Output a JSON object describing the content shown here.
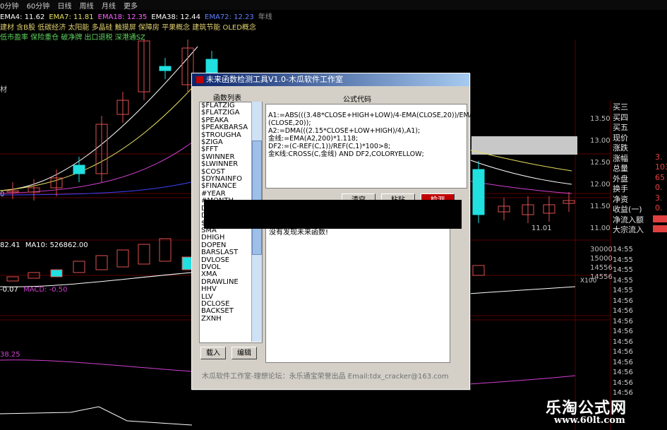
{
  "colors": {
    "up": "#e05050",
    "down": "#20e0e0",
    "grid": "#5a0000",
    "ema_white": "#ffffff",
    "ema_yellow": "#e8e060",
    "ema_magenta": "#d040d0",
    "ema_blue": "#4040ff"
  },
  "period_tabs": [
    "0分钟",
    "60分钟",
    "日线",
    "周线",
    "月线",
    "更多"
  ],
  "ema_legend": [
    {
      "label": "EMA4: 11.62",
      "color": "#ffffff"
    },
    {
      "label": "EMA7: 11.81",
      "color": "#e8e060"
    },
    {
      "label": "EMA18: 12.35",
      "color": "#ff60ff"
    },
    {
      "label": "EMA38: 12.44",
      "color": "#ffffff"
    },
    {
      "label": "EMA72: 12.23",
      "color": "#6080ff"
    },
    {
      "label": "年线",
      "color": "#999999"
    }
  ],
  "concepts_line1": "建材                含B股 低碳经济 太阳能 多晶硅 触摸屏 保障房 平果概念 建筑节能 OLED概念",
  "concepts_line2": "低市盈率 保险重仓 破净牌 出口退税 深港通SZ",
  "left_label_1": "材",
  "left_label_2": "0",
  "ma_legend": {
    "ma5": "82.41",
    "ma10": "MA10: 526862.00"
  },
  "macd_legend": {
    "value": "-0.07",
    "macd": "MACD: -0.50"
  },
  "bottom_value": "38.25",
  "low_price_label": "11.01",
  "price_axis": [
    "13.50",
    "13.00",
    "12.50",
    "12.00",
    "11.50",
    "11.00"
  ],
  "vol_axis": [
    "30000",
    "15000",
    "14556",
    "14556"
  ],
  "vol_marker": "X100",
  "quote_panel": [
    {
      "label": "买三",
      "value": ""
    },
    {
      "label": "买四",
      "value": ""
    },
    {
      "label": "买五",
      "value": ""
    },
    {
      "label": "现价",
      "value": ""
    },
    {
      "label": "涨跌",
      "value": ""
    },
    {
      "label": "涨幅",
      "value": "3."
    },
    {
      "label": "总量",
      "value": "103"
    },
    {
      "label": "外盘",
      "value": "65"
    },
    {
      "label": "换手",
      "value": "0."
    },
    {
      "label": "净资",
      "value": "3."
    },
    {
      "label": "收益(一)",
      "value": "0."
    },
    {
      "label": "净流入额",
      "value": ""
    },
    {
      "label": "大宗流入",
      "value": ""
    }
  ],
  "tick_times": [
    "14:55",
    "14:55",
    "14:55",
    "14:55",
    "14:55",
    "14:56",
    "14:56",
    "14:56",
    "14:56",
    "14:56",
    "14:56",
    "14:56",
    "14:56",
    "14:56",
    "14:56"
  ],
  "dialog": {
    "title": "未来函数检测工具V1.0-木瓜软件工作室",
    "list_header": "函数列表",
    "functions": [
      "$FLATZIG",
      "$FLATZIGA",
      "$PEAKA",
      "$PEAKBARSA",
      "$TROUGHA",
      "$ZIGA",
      "$FFT",
      "$WINNER",
      "$LWINNER",
      "$COST",
      "$DYNAINFO",
      "$FINANCE",
      "#YEAR",
      "#MONTH",
      "",
      "",
      "",
      "DOPEN",
      "DLOW",
      "$BACKSET",
      "SMA",
      "DHIGH",
      "DOPEN",
      "BARSLAST",
      "DVLOSE",
      "DVOL",
      "XMA",
      "DRAWLINE",
      "HHV",
      "LLV",
      "DCLOSE",
      "BACKSET",
      "ZXNH"
    ],
    "code_header": "公式代码",
    "code_lines": [
      "A1:=ABS(((3.48*CLOSE+HIGH+LOW)/4-EMA(CLOSE,20))/EMA",
      "(CLOSE,20));",
      "A2:=DMA(((2.15*CLOSE+LOW+HIGH)/4),A1);",
      "金线:=EMA(A2,200)*1.118;",
      "DF2:=(C-REF(C,1))/REF(C,1)*100>8;",
      "金K线:CROSS(C,金线) AND DF2,COLORYELLOW;"
    ],
    "btn_clear": "清空",
    "btn_paste": "粘贴",
    "btn_detect": "检测",
    "result_text": "没有发现未来函数!",
    "btn_load": "载入",
    "btn_edit": "编辑",
    "footer": "木瓜软件工作室-理想论坛：永乐通宝荣誉出品    Email:tdx_cracker@163.com"
  },
  "watermark": {
    "name": "乐淘公式网",
    "url": "www.60lt.com"
  }
}
